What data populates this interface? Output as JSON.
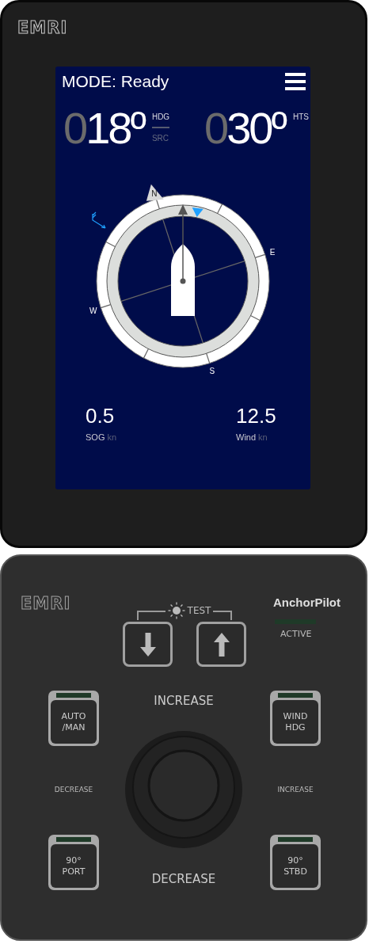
{
  "device_logo": "EMRI",
  "display": {
    "mode": "MODE: Ready",
    "headings": [
      {
        "lead": "0",
        "value": "18º",
        "labels": [
          {
            "text": "HDG",
            "active": true
          },
          {
            "text": "SRC",
            "active": false
          }
        ]
      },
      {
        "lead": "0",
        "value": "30º",
        "labels": [
          {
            "text": "HTS",
            "active": true
          }
        ]
      }
    ],
    "compass": {
      "cardinals": [
        "N",
        "E",
        "S",
        "W"
      ]
    },
    "readouts": [
      {
        "value": "0.5",
        "label": "SOG",
        "unit": "kn"
      },
      {
        "value": "12.5",
        "label": "Wind",
        "unit": "kn"
      }
    ]
  },
  "panel": {
    "logo": "EMRI",
    "product": "AnchorPilot",
    "status": {
      "label": "ACTIVE",
      "lit": false
    },
    "test_label": "TEST",
    "arrow_buttons": [
      {
        "kind": "down"
      },
      {
        "kind": "up"
      }
    ],
    "knob_labels": {
      "top": "INCREASE",
      "left": "DECREASE",
      "right": "INCREASE",
      "bottom": "DECREASE"
    },
    "buttons": [
      {
        "lines": [
          "AUTO",
          "/MAN"
        ],
        "lit": false
      },
      {
        "lines": [
          "WIND",
          "HDG"
        ],
        "lit": false
      },
      {
        "lines": [
          "90°",
          "PORT"
        ],
        "lit": false
      },
      {
        "lines": [
          "90°",
          "STBD"
        ],
        "lit": false
      }
    ]
  }
}
